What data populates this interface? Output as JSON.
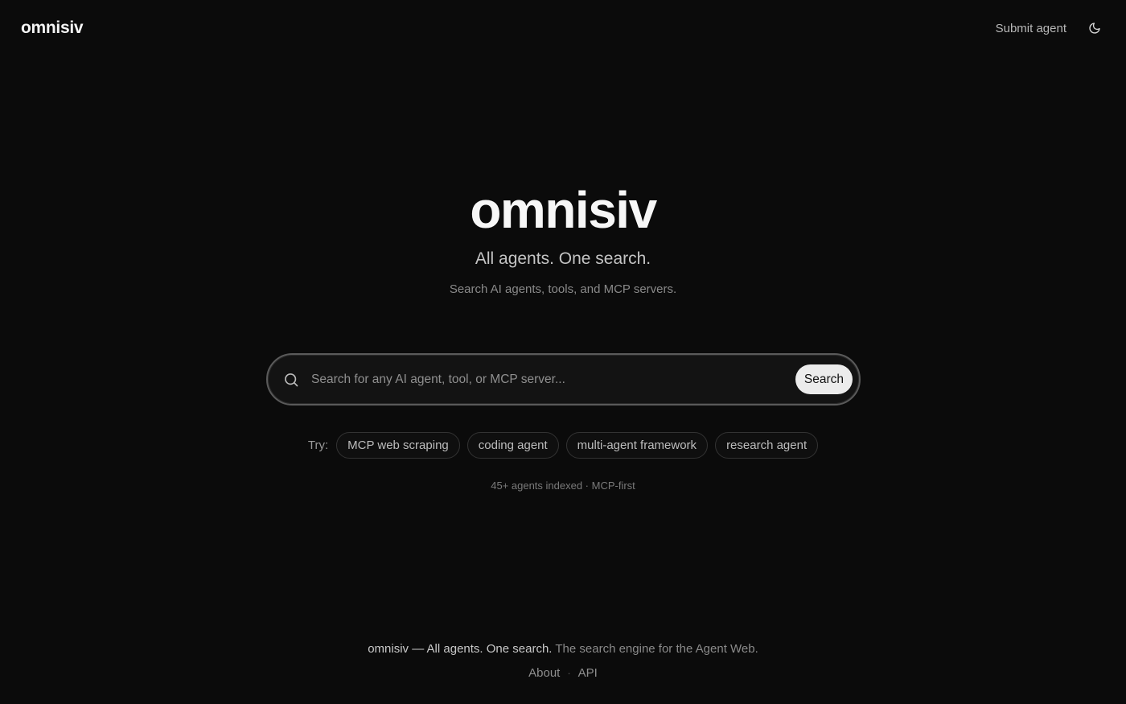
{
  "header": {
    "brand": "omnisiv",
    "submit_label": "Submit agent",
    "theme_icon": "moon-icon"
  },
  "hero": {
    "title": "omnisiv",
    "tagline": "All agents. One search.",
    "subtitle": "Search AI agents, tools, and MCP servers."
  },
  "search": {
    "placeholder": "Search for any AI agent, tool, or MCP server...",
    "value": "",
    "button_label": "Search",
    "icon": "search-icon"
  },
  "suggestions": {
    "label": "Try:",
    "items": [
      "MCP web scraping",
      "coding agent",
      "multi-agent framework",
      "research agent"
    ]
  },
  "stats": {
    "text": "45+ agents indexed · MCP-first"
  },
  "footer": {
    "brand_text": "omnisiv — All agents. One search.",
    "description": " The search engine for the Agent Web.",
    "links": [
      "About",
      "API"
    ],
    "separator": "·"
  },
  "colors": {
    "background": "#0b0b0b",
    "text": "#ededed",
    "muted": "#8a8a8a",
    "button_bg": "#ececec"
  }
}
